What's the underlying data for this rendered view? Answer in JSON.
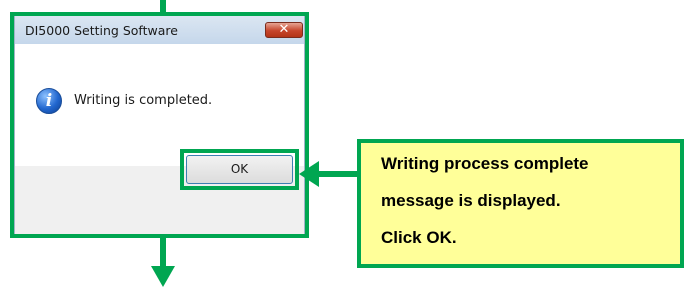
{
  "dialog": {
    "title": "DI5000 Setting Software",
    "close_glyph": "✕",
    "message": "Writing is completed.",
    "icon": "info-icon",
    "ok_label": "OK"
  },
  "callout": {
    "lines": [
      "Writing process complete",
      "message is displayed.",
      "Click OK."
    ]
  },
  "colors": {
    "highlight_green": "#00a651",
    "callout_fill": "#ffff99",
    "close_button_red": "#c6452b"
  }
}
